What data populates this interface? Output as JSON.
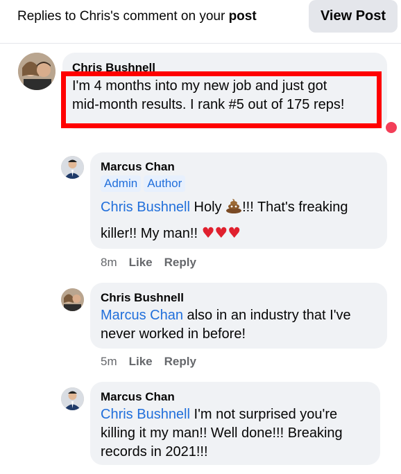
{
  "header": {
    "title_prefix": "Replies to Chris's comment on your ",
    "title_bold": "post",
    "view_post_label": "View Post"
  },
  "comments": [
    {
      "author": "Chris Bushnell",
      "line1": "I'm 4 months into my new job and just got",
      "line2": "mid-month results. I rank #5 out of 175 reps!"
    },
    {
      "author": "Marcus Chan",
      "badges": [
        "Admin",
        "Author"
      ],
      "mention": "Chris Bushnell",
      "text1": " Holy ",
      "text1b": "!!! That's freaking",
      "text2": "killer!! My man!! ",
      "time": "8m",
      "like": "Like",
      "reply": "Reply"
    },
    {
      "author": "Chris Bushnell",
      "mention": "Marcus Chan",
      "text1": " also in an industry that I've",
      "text2": "never worked in before!",
      "time": "5m",
      "like": "Like",
      "reply": "Reply"
    },
    {
      "author": "Marcus Chan",
      "mention": "Chris Bushnell",
      "text1": " I'm not surprised you're",
      "text2": "killing it my man!! Well done!!! Breaking",
      "text3": "records in 2021!!!"
    }
  ],
  "colors": {
    "mention": "#216fdb",
    "bubble": "#f0f2f5",
    "highlight": "#ff0000"
  }
}
